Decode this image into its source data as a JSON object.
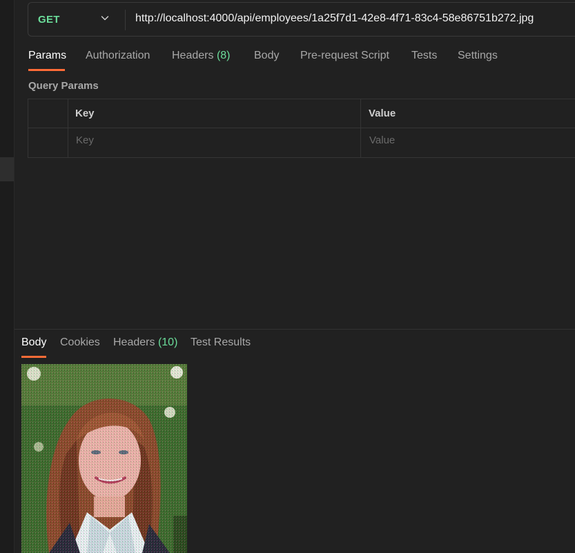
{
  "request": {
    "method": "GET",
    "url": "http://localhost:4000/api/employees/1a25f7d1-42e8-4f71-83c4-58e86751b272.jpg"
  },
  "request_tabs": [
    {
      "label": "Params",
      "count": ""
    },
    {
      "label": "Authorization",
      "count": ""
    },
    {
      "label": "Headers",
      "count": "(8)"
    },
    {
      "label": "Body",
      "count": ""
    },
    {
      "label": "Pre-request Script",
      "count": ""
    },
    {
      "label": "Tests",
      "count": ""
    },
    {
      "label": "Settings",
      "count": ""
    }
  ],
  "query_params": {
    "title": "Query Params",
    "headers": {
      "key": "Key",
      "value": "Value"
    },
    "placeholders": {
      "key": "Key",
      "value": "Value"
    }
  },
  "response_tabs": [
    {
      "label": "Body",
      "count": ""
    },
    {
      "label": "Cookies",
      "count": ""
    },
    {
      "label": "Headers",
      "count": "(10)"
    },
    {
      "label": "Test Results",
      "count": ""
    }
  ],
  "colors": {
    "accent": "#ff6c37",
    "method_get": "#6bdd9a",
    "count": "#6bdd9a",
    "background": "#212121"
  },
  "icons": {
    "method_dropdown": "chevron-down-icon"
  }
}
